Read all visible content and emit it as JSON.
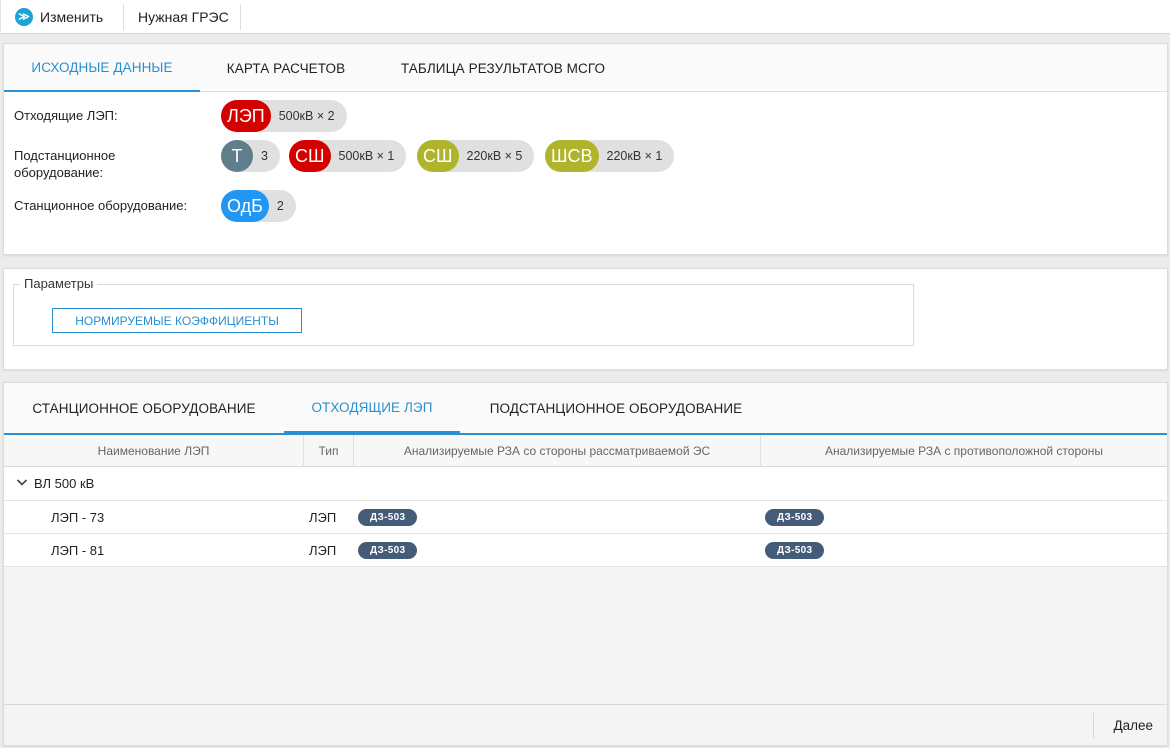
{
  "toolbar": {
    "edit_label": "Изменить",
    "edit_icon": "≫",
    "station_label": "Нужная ГРЭС"
  },
  "top_tabs": [
    {
      "label": "ИСХОДНЫЕ ДАННЫЕ",
      "active": true
    },
    {
      "label": "КАРТА РАСЧЕТОВ",
      "active": false
    },
    {
      "label": "ТАБЛИЦА РЕЗУЛЬТАТОВ МСГО",
      "active": false
    }
  ],
  "source_data": {
    "lines_label": "Отходящие ЛЭП:",
    "substation_label_1": "Подстанционное",
    "substation_label_2": "оборудование:",
    "station_label": "Станционное оборудование:",
    "chips": {
      "lep": {
        "abbr": "ЛЭП",
        "text": "500кВ × 2",
        "color": "#d40000"
      },
      "t": {
        "abbr": "Т",
        "text": "3",
        "color": "#607d8b"
      },
      "sh500": {
        "abbr": "СШ",
        "text": "500кВ × 1",
        "color": "#d40000"
      },
      "sh220": {
        "abbr": "СШ",
        "text": "220кВ × 5",
        "color": "#afb42b"
      },
      "shsv": {
        "abbr": "ШСВ",
        "text": "220кВ × 1",
        "color": "#afb42b"
      },
      "odb": {
        "abbr": "ОдБ",
        "text": "2",
        "color": "#2196f3"
      }
    }
  },
  "params": {
    "legend": "Параметры",
    "button_label": "НОРМИРУЕМЫЕ КОЭФФИЦИЕНТЫ"
  },
  "bottom_tabs": [
    {
      "label": "СТАНЦИОННОЕ ОБОРУДОВАНИЕ",
      "active": false
    },
    {
      "label": "ОТХОДЯЩИЕ ЛЭП",
      "active": true
    },
    {
      "label": "ПОДСТАНЦИОННОЕ ОБОРУДОВАНИЕ",
      "active": false
    }
  ],
  "grid": {
    "columns": [
      "Наименование ЛЭП",
      "Тип",
      "Анализируемые РЗА со стороны рассматриваемой ЭС",
      "Анализируемые РЗА с противоположной стороны"
    ],
    "group_label": "ВЛ 500 кВ",
    "rows": [
      {
        "name": "ЛЭП - 73",
        "type": "ЛЭП",
        "local": "ДЗ-503",
        "remote": "ДЗ-503"
      },
      {
        "name": "ЛЭП - 81",
        "type": "ЛЭП",
        "local": "ДЗ-503",
        "remote": "ДЗ-503"
      }
    ]
  },
  "footer": {
    "next_label": "Далее"
  },
  "colors": {
    "accent": "#2a8fd0",
    "tag_bg": "#455c78"
  }
}
